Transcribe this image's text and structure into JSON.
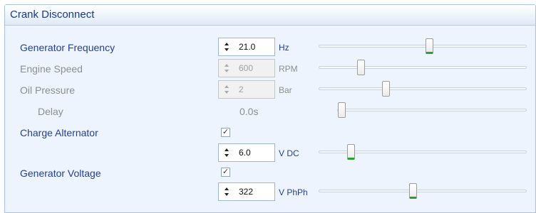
{
  "panel": {
    "title": "Crank Disconnect"
  },
  "rows": {
    "generator_frequency": {
      "label": "Generator Frequency",
      "value": "21.0",
      "unit": "Hz",
      "slider_fraction": 0.53
    },
    "engine_speed": {
      "label": "Engine Speed",
      "value": "600",
      "unit": "RPM",
      "slider_fraction": 0.2
    },
    "oil_pressure": {
      "label": "Oil Pressure",
      "value": "2",
      "unit": "Bar",
      "slider_fraction": 0.32
    },
    "delay": {
      "label": "Delay",
      "value": "0.0s",
      "slider_fraction": 0.0
    },
    "charge_alternator": {
      "label": "Charge Alternator",
      "checked_glyph": "✓",
      "value": "6.0",
      "unit": "V DC",
      "slider_fraction": 0.15
    },
    "generator_voltage": {
      "label": "Generator Voltage",
      "checked_glyph": "✓",
      "value": "322",
      "unit": "V PhPh",
      "slider_fraction": 0.45
    }
  },
  "icons": {
    "spin_up": "triangle-up-icon",
    "spin_down": "triangle-down-icon",
    "check": "checkmark-icon"
  },
  "colors": {
    "label_active": "#233f93",
    "label_disabled": "#8e8e8e",
    "thumb_active_accent": "#2e9f2e",
    "panel_background": "#eef4fd"
  }
}
